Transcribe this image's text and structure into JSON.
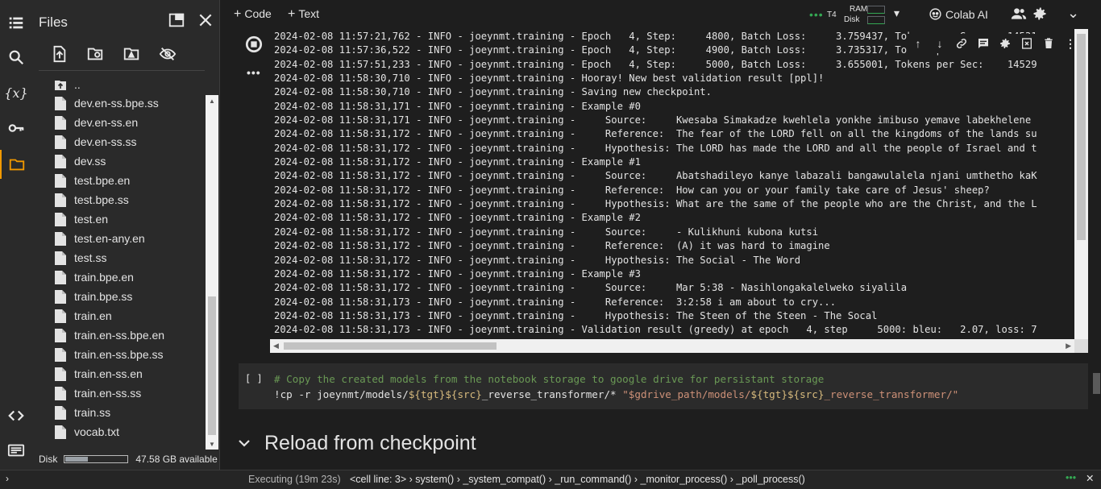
{
  "sidebar": {
    "title": "Files",
    "items": [
      {
        "icon": "list-icon"
      },
      {
        "icon": "search-icon"
      },
      {
        "icon": "variables-icon",
        "label": "{x}"
      },
      {
        "icon": "key-icon"
      },
      {
        "icon": "folder-icon"
      },
      {
        "icon": "code-brackets-icon"
      },
      {
        "icon": "terminal-icon"
      }
    ]
  },
  "files": {
    "parent": "..",
    "list": [
      "dev.en-ss.bpe.ss",
      "dev.en-ss.en",
      "dev.en-ss.ss",
      "dev.ss",
      "test.bpe.en",
      "test.bpe.ss",
      "test.en",
      "test.en-any.en",
      "test.ss",
      "train.bpe.en",
      "train.bpe.ss",
      "train.en",
      "train.en-ss.bpe.en",
      "train.en-ss.bpe.ss",
      "train.en-ss.en",
      "train.en-ss.ss",
      "train.ss",
      "vocab.txt"
    ],
    "disk_label": "Disk",
    "disk_available": "47.58 GB available",
    "disk_used_fraction": 0.35
  },
  "toolbar": {
    "code_label": "Code",
    "text_label": "Text",
    "runtime": "T4",
    "ram_label": "RAM",
    "disk_label": "Disk",
    "colab_ai_label": "Colab AI"
  },
  "output": {
    "lines": [
      "2024-02-08 11:57:21,762 - INFO - joeynmt.training - Epoch   4, Step:     4800, Batch Loss:     3.759437, Tokens per Sec:    14531",
      "2024-02-08 11:57:36,522 - INFO - joeynmt.training - Epoch   4, Step:     4900, Batch Loss:     3.735317, Tokens per Sec:    14453",
      "2024-02-08 11:57:51,233 - INFO - joeynmt.training - Epoch   4, Step:     5000, Batch Loss:     3.655001, Tokens per Sec:    14529",
      "2024-02-08 11:58:30,710 - INFO - joeynmt.training - Hooray! New best validation result [ppl]!",
      "2024-02-08 11:58:30,710 - INFO - joeynmt.training - Saving new checkpoint.",
      "2024-02-08 11:58:31,171 - INFO - joeynmt.training - Example #0",
      "2024-02-08 11:58:31,171 - INFO - joeynmt.training -     Source:     Kwesaba Simakadze kwehlela yonkhe imibuso yemave labekhelene",
      "2024-02-08 11:58:31,172 - INFO - joeynmt.training -     Reference:  The fear of the LORD fell on all the kingdoms of the lands su",
      "2024-02-08 11:58:31,172 - INFO - joeynmt.training -     Hypothesis: The LORD has made the LORD and all the people of Israel and t",
      "2024-02-08 11:58:31,172 - INFO - joeynmt.training - Example #1",
      "2024-02-08 11:58:31,172 - INFO - joeynmt.training -     Source:     Abatshadileyo kanye labazali bangawulalela njani umthetho kaK",
      "2024-02-08 11:58:31,172 - INFO - joeynmt.training -     Reference:  How can you or your family take care of Jesus' sheep?",
      "2024-02-08 11:58:31,172 - INFO - joeynmt.training -     Hypothesis: What are the same of the people who are the Christ, and the L",
      "2024-02-08 11:58:31,172 - INFO - joeynmt.training - Example #2",
      "2024-02-08 11:58:31,172 - INFO - joeynmt.training -     Source:     - Kulikhuni kubona kutsi",
      "2024-02-08 11:58:31,172 - INFO - joeynmt.training -     Reference:  (A) it was hard to imagine",
      "2024-02-08 11:58:31,172 - INFO - joeynmt.training -     Hypothesis: The Social - The Word",
      "2024-02-08 11:58:31,172 - INFO - joeynmt.training - Example #3",
      "2024-02-08 11:58:31,172 - INFO - joeynmt.training -     Source:     Mar 5:38 - Nasihlongakalelweko siyalila",
      "2024-02-08 11:58:31,173 - INFO - joeynmt.training -     Reference:  3:2:58 i am about to cry...",
      "2024-02-08 11:58:31,173 - INFO - joeynmt.training -     Hypothesis: The Steen of the Steen - The Socal",
      "2024-02-08 11:58:31,173 - INFO - joeynmt.training - Validation result (greedy) at epoch   4, step     5000: bleu:   2.07, loss: 7"
    ]
  },
  "code_cell": {
    "bracket": "[ ]",
    "comment": "# Copy the created models from the notebook storage to google drive for persistant storage",
    "cmd_prefix": "!cp -r joeynmt/models/",
    "var_tgt": "${tgt}",
    "var_src": "${src}",
    "cmd_mid": "_reverse_transformer/* ",
    "str_prefix": "\"$gdrive_path/models/",
    "str_suffix": "_reverse_transformer/\""
  },
  "section": {
    "title": "Reload from checkpoint"
  },
  "status": {
    "executing": "Executing (19m 23s)",
    "trace": [
      "<cell line: 3>",
      "system()",
      "_system_compat()",
      "_run_command()",
      "_monitor_process()",
      "_poll_process()"
    ]
  }
}
